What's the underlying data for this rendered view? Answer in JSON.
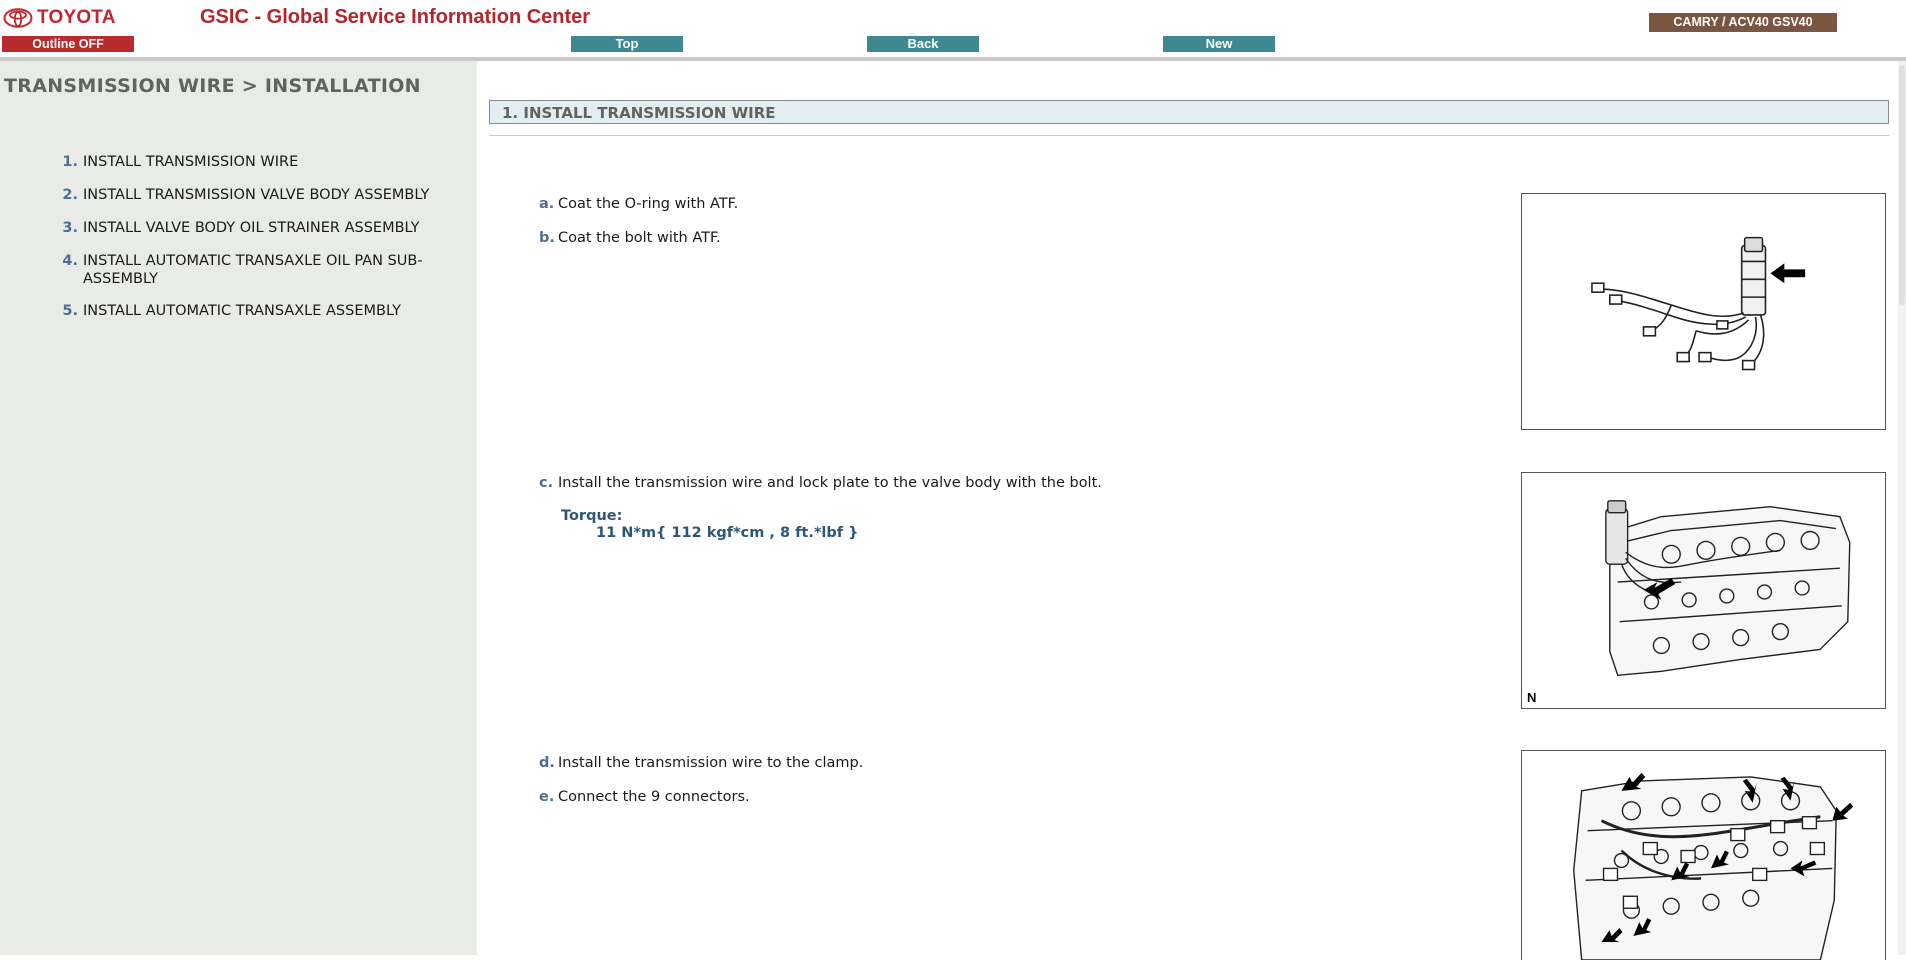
{
  "header": {
    "brand": "TOYOTA",
    "app_title": "GSIC - Global Service Information Center",
    "outline_button": "Outline OFF",
    "nav": {
      "top": "Top",
      "back": "Back",
      "new": "New"
    },
    "model": "CAMRY / ACV40 GSV40"
  },
  "sidebar": {
    "title": "TRANSMISSION WIRE > INSTALLATION",
    "items": [
      {
        "num": "1.",
        "label": "INSTALL TRANSMISSION WIRE"
      },
      {
        "num": "2.",
        "label": "INSTALL TRANSMISSION VALVE BODY ASSEMBLY"
      },
      {
        "num": "3.",
        "label": "INSTALL VALVE BODY OIL STRAINER ASSEMBLY"
      },
      {
        "num": "4.",
        "label": "INSTALL AUTOMATIC TRANSAXLE OIL PAN SUB-ASSEMBLY"
      },
      {
        "num": "5.",
        "label": "INSTALL AUTOMATIC TRANSAXLE ASSEMBLY"
      }
    ]
  },
  "content": {
    "step_title": "1. INSTALL TRANSMISSION WIRE",
    "substeps": [
      {
        "letter": "a.",
        "text": "Coat the O-ring with ATF."
      },
      {
        "letter": "b.",
        "text": "Coat the bolt with ATF."
      },
      {
        "letter": "c.",
        "text": "Install the transmission wire and lock plate to the valve body with the bolt."
      },
      {
        "letter": "d.",
        "text": "Install the transmission wire to the clamp."
      },
      {
        "letter": "e.",
        "text": "Connect the 9 connectors."
      }
    ],
    "torque_label": "Torque:",
    "torque_value": "11 N*m{ 112 kgf*cm , 8 ft.*lbf }",
    "figures": [
      {
        "label": ""
      },
      {
        "label": "N"
      },
      {
        "label": ""
      }
    ]
  }
}
